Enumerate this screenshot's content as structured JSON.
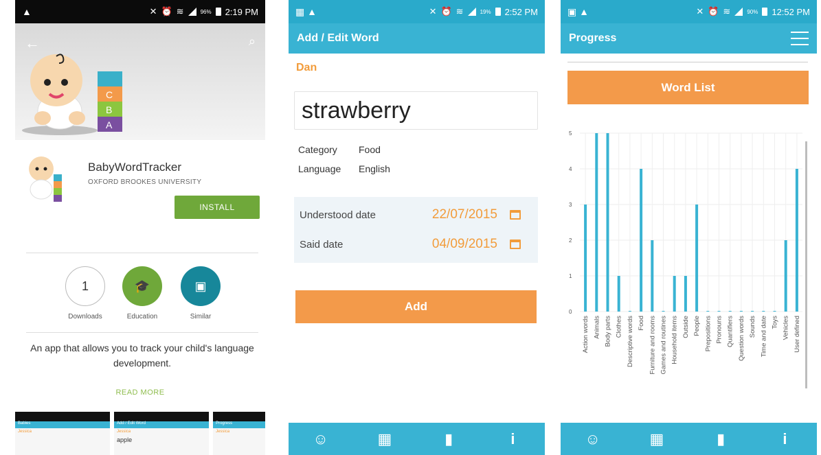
{
  "phone1": {
    "status": {
      "time": "2:19 PM",
      "battery": "96%"
    },
    "app": {
      "title": "BabyWordTracker",
      "developer": "OXFORD BROOKES UNIVERSITY"
    },
    "install_label": "INSTALL",
    "stats": [
      {
        "value": "1",
        "label": "Downloads",
        "icon": "counter"
      },
      {
        "value": "",
        "label": "Education",
        "icon": "graduation-cap-icon"
      },
      {
        "value": "",
        "label": "Similar",
        "icon": "similar-cards-icon"
      }
    ],
    "description": "An app that allows you to track your child's language development.",
    "read_more": "READ MORE",
    "screenshots": [
      {
        "title": "Babies",
        "line": "Jessica"
      },
      {
        "title": "Add / Edit Word",
        "line": "Jessica",
        "word": "apple"
      },
      {
        "title": "Progress",
        "line": "Jessica"
      }
    ]
  },
  "phone2": {
    "status": {
      "time": "2:52 PM",
      "battery": "19%"
    },
    "appbar_title": "Add / Edit Word",
    "child_name": "Dan",
    "word": "strawberry",
    "category_label": "Category",
    "category_value": "Food",
    "language_label": "Language",
    "language_value": "English",
    "understood_label": "Understood date",
    "understood_value": "22/07/2015",
    "said_label": "Said date",
    "said_value": "04/09/2015",
    "add_label": "Add"
  },
  "phone3": {
    "status": {
      "time": "12:52 PM",
      "battery": "90%"
    },
    "appbar_title": "Progress",
    "word_list_label": "Word List"
  },
  "colors": {
    "blue": "#39b3d3",
    "orange": "#f39a4a",
    "green": "#6fa83a",
    "text_orange": "#f29c3b"
  },
  "chart_data": {
    "type": "bar",
    "title": "",
    "xlabel": "",
    "ylabel": "",
    "ylim": [
      0,
      5
    ],
    "yticks": [
      0,
      1,
      2,
      3,
      4,
      5
    ],
    "grid": true,
    "categories": [
      "Action words",
      "Animals",
      "Body parts",
      "Clothes",
      "Descriptive words",
      "Food",
      "Furniture and rooms",
      "Games and routines",
      "Household items",
      "Outside",
      "People",
      "Prepositions",
      "Pronouns",
      "Quantifiers",
      "Question words",
      "Sounds",
      "Time and date",
      "Toys",
      "Vehicles",
      "User defined"
    ],
    "values": [
      3,
      5,
      5,
      1,
      0,
      4,
      2,
      0,
      1,
      1,
      3,
      0,
      0,
      0,
      0,
      0,
      0,
      0,
      2,
      4
    ],
    "bar_color": "#39b3d3"
  }
}
